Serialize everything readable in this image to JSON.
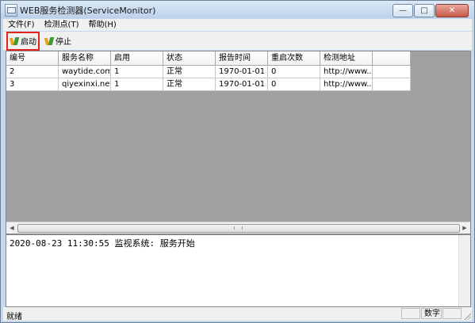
{
  "window": {
    "title": "WEB服务检测器(ServiceMonitor)"
  },
  "menu": [
    {
      "label": "文件(F)"
    },
    {
      "label": "检测点(T)"
    },
    {
      "label": "帮助(H)"
    }
  ],
  "toolbar": {
    "start_label": "启动",
    "stop_label": "停止"
  },
  "table": {
    "columns": [
      "编号",
      "服务名称",
      "启用",
      "状态",
      "报告时间",
      "重启次数",
      "检测地址"
    ],
    "rows": [
      [
        "2",
        "waytide.com",
        "1",
        "正常",
        "1970-01-01 ...",
        "0",
        "http://www...."
      ],
      [
        "3",
        "qiyexinxi.net",
        "1",
        "正常",
        "1970-01-01 ...",
        "0",
        "http://www...."
      ]
    ]
  },
  "log": {
    "line": "2020-08-23 11:30:55 监视系统: 服务开始"
  },
  "status": {
    "text": "就绪",
    "panel2": "数字"
  },
  "colors": {
    "accent_highlight": "#e0241d",
    "grid_background": "#a0a0a0"
  }
}
